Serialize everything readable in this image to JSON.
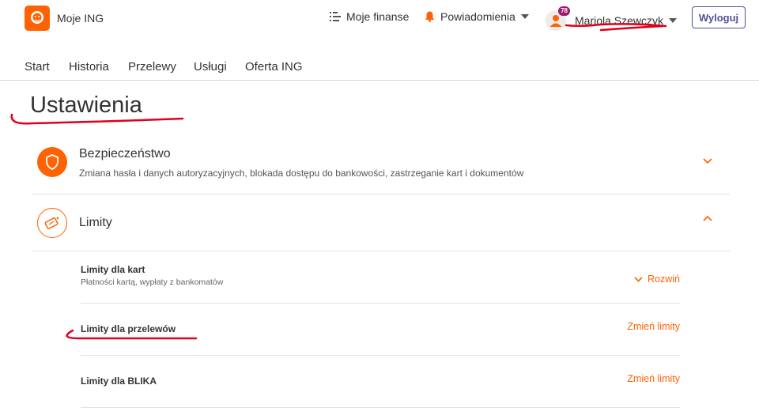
{
  "header": {
    "app_title": "Moje ING",
    "finanse_label": "Moje finanse",
    "notifications_label": "Powiadomienia",
    "user_name": "Mariola Szewczyk",
    "badge_count": "78",
    "logout_label": "Wyloguj"
  },
  "nav": {
    "items": [
      {
        "label": "Start"
      },
      {
        "label": "Historia"
      },
      {
        "label": "Przelewy"
      },
      {
        "label": "Usługi"
      },
      {
        "label": "Oferta ING"
      }
    ]
  },
  "page": {
    "title": "Ustawienia"
  },
  "sections": [
    {
      "title": "Bezpieczeństwo",
      "description": "Zmiana hasła i danych autoryzacyjnych, blokada dostępu do bankowości, zastrzeganie kart i dokumentów",
      "icon": "shield-icon",
      "expanded": false
    },
    {
      "title": "Limity",
      "icon": "limits-icon",
      "expanded": true,
      "items": [
        {
          "title": "Limity dla kart",
          "description": "Płatności kartą, wypłaty z bankomatów",
          "action": "Rozwiń"
        },
        {
          "title": "Limity dla przelewów",
          "action": "Zmień limity"
        },
        {
          "title": "Limity dla BLIKA",
          "action": "Zmień limity"
        }
      ]
    }
  ],
  "colors": {
    "accent": "#ff6200",
    "logout_border": "#525199",
    "badge": "#a0186e",
    "annotation": "#e0001a"
  }
}
